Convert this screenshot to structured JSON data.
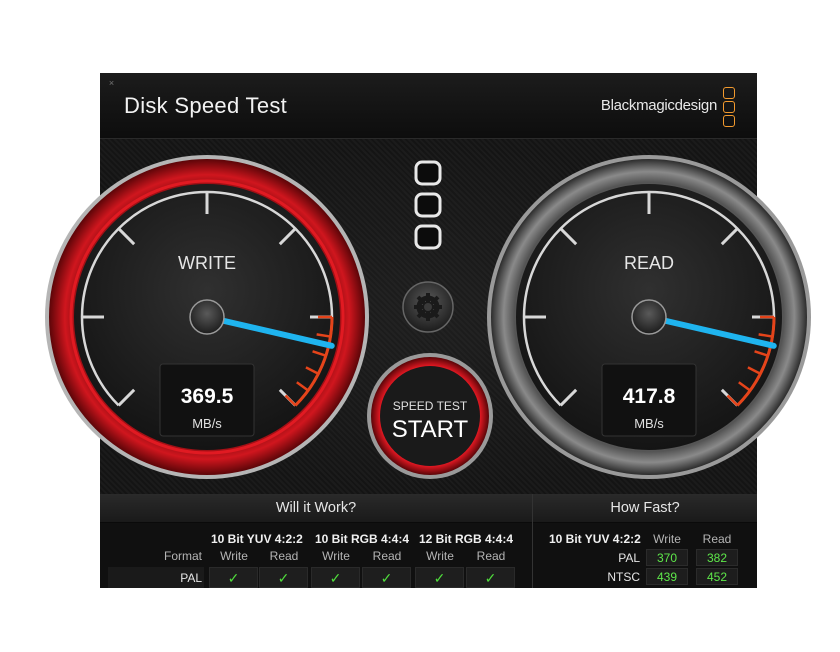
{
  "window": {
    "title": "Disk Speed Test",
    "brand": "Blackmagicdesign",
    "close_label": "×"
  },
  "write_gauge": {
    "label": "WRITE",
    "value": "369.5",
    "unit": "MB/s"
  },
  "read_gauge": {
    "label": "READ",
    "value": "417.8",
    "unit": "MB/s"
  },
  "start_button": {
    "top_label": "SPEED TEST",
    "main_label": "START"
  },
  "settings": {
    "icon": "gear-icon"
  },
  "will_it_work": {
    "title": "Will it Work?",
    "row_header": "Format",
    "groups": [
      "10 Bit YUV 4:2:2",
      "10 Bit RGB 4:4:4",
      "12 Bit RGB 4:4:4"
    ],
    "sub_headers": [
      "Write",
      "Read",
      "Write",
      "Read",
      "Write",
      "Read"
    ],
    "rows": [
      {
        "label": "PAL",
        "checks": [
          "✓",
          "✓",
          "✓",
          "✓",
          "✓",
          "✓"
        ]
      }
    ]
  },
  "how_fast": {
    "title": "How Fast?",
    "group": "10 Bit YUV 4:2:2",
    "sub_headers": [
      "Write",
      "Read"
    ],
    "rows": [
      {
        "label": "PAL",
        "write": "370",
        "read": "382"
      },
      {
        "label": "NTSC",
        "write": "439",
        "read": "452"
      }
    ]
  },
  "colors": {
    "needle": "#1fb4ef",
    "write_ring": "#c6121a",
    "danger_ticks": "#e5441a",
    "check": "#4fdc3c",
    "fast_values": "#5ee84a",
    "brand_logo": "#f29a2e"
  }
}
